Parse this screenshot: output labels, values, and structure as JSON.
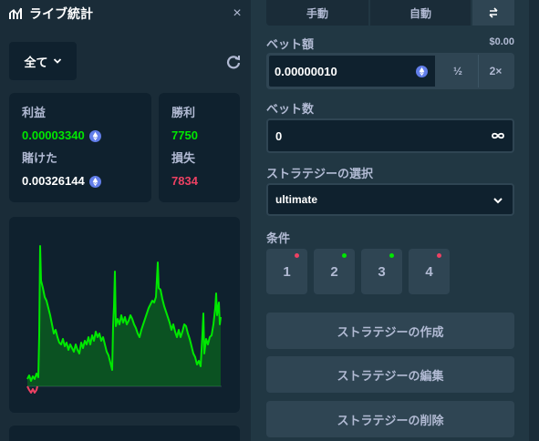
{
  "stats": {
    "title": "ライブ統計",
    "close": "×",
    "filter": "全て",
    "profit_label": "利益",
    "profit_value": "0.00003340",
    "wagered_label": "賭けた",
    "wagered_value": "0.00326144",
    "wins_label": "勝利",
    "wins_value": "7750",
    "losses_label": "損失",
    "losses_value": "7834"
  },
  "colors": {
    "accent_green": "#00e701",
    "loss_red": "#ed4163",
    "eth_blue": "#627eea"
  },
  "icons": {
    "header": "chart-icon",
    "refresh": "refresh-icon",
    "currency": "ethereum-icon",
    "swap": "swap-icon",
    "infinity": "infinity-icon"
  },
  "controls": {
    "tab_manual": "手動",
    "tab_auto": "自動",
    "bet_amount_label": "ベット額",
    "bet_amount_usd": "$0.00",
    "bet_amount_value": "0.00000010",
    "half_label": "½",
    "double_label": "2×",
    "bet_count_label": "ベット数",
    "bet_count_value": "0",
    "strategy_label": "ストラテジーの選択",
    "strategy_value": "ultimate",
    "conditions_label": "条件",
    "conditions": [
      {
        "label": "1",
        "dot": "#ed4163"
      },
      {
        "label": "2",
        "dot": "#00e701"
      },
      {
        "label": "3",
        "dot": "#00e701"
      },
      {
        "label": "4",
        "dot": "#ed4163"
      }
    ],
    "create_strategy": "ストラテジーの作成",
    "edit_strategy": "ストラテジーの編集",
    "delete_strategy": "ストラテジーの削除"
  }
}
